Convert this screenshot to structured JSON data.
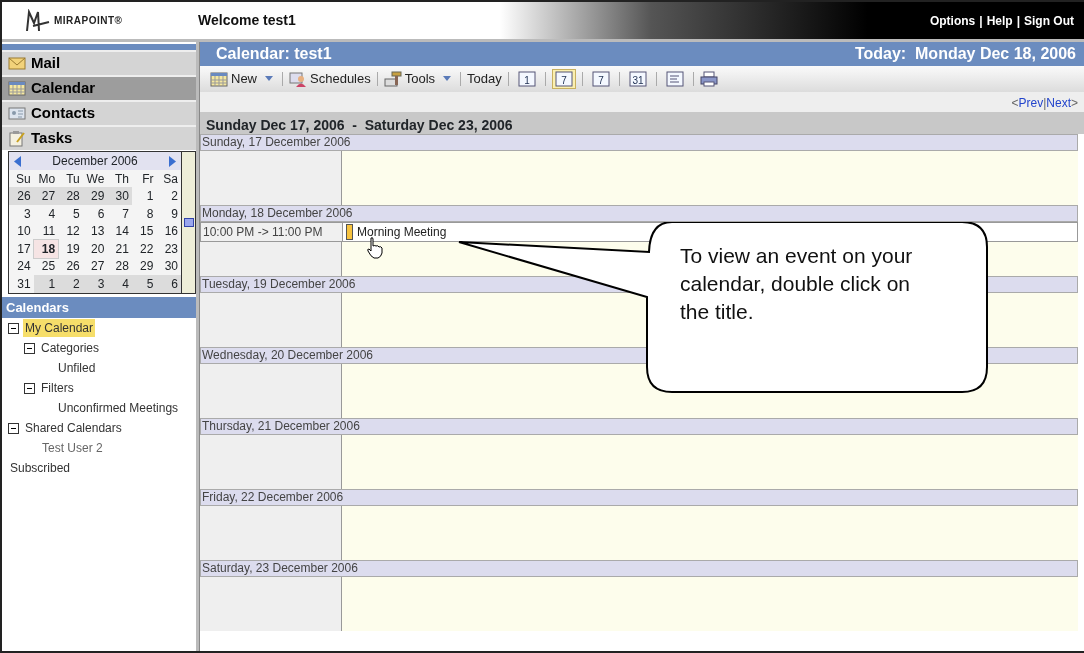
{
  "header": {
    "logo": "MIRAPOINT",
    "logo_mark": "®",
    "welcome": "Welcome test1",
    "links": [
      "Options",
      "Help",
      "Sign Out"
    ],
    "separator": "|"
  },
  "nav": [
    {
      "label": "Mail",
      "selected": false
    },
    {
      "label": "Calendar",
      "selected": true
    },
    {
      "label": "Contacts",
      "selected": false
    },
    {
      "label": "Tasks",
      "selected": false
    }
  ],
  "mini_calendar": {
    "month": "December 2006",
    "weekdays": [
      "Su",
      "Mo",
      "Tu",
      "We",
      "Th",
      "Fr",
      "Sa"
    ],
    "weeks": [
      [
        {
          "d": "26",
          "other_month": true,
          "today": false
        },
        {
          "d": "27",
          "other_month": true,
          "today": false
        },
        {
          "d": "28",
          "other_month": true,
          "today": false
        },
        {
          "d": "29",
          "other_month": true,
          "today": false
        },
        {
          "d": "30",
          "other_month": true,
          "today": false
        },
        {
          "d": "1",
          "other_month": false,
          "today": false
        },
        {
          "d": "2",
          "other_month": false,
          "today": false
        }
      ],
      [
        {
          "d": "3",
          "other_month": false,
          "today": false
        },
        {
          "d": "4",
          "other_month": false,
          "today": false
        },
        {
          "d": "5",
          "other_month": false,
          "today": false
        },
        {
          "d": "6",
          "other_month": false,
          "today": false
        },
        {
          "d": "7",
          "other_month": false,
          "today": false
        },
        {
          "d": "8",
          "other_month": false,
          "today": false
        },
        {
          "d": "9",
          "other_month": false,
          "today": false
        }
      ],
      [
        {
          "d": "10",
          "other_month": false,
          "today": false
        },
        {
          "d": "11",
          "other_month": false,
          "today": false
        },
        {
          "d": "12",
          "other_month": false,
          "today": false
        },
        {
          "d": "13",
          "other_month": false,
          "today": false
        },
        {
          "d": "14",
          "other_month": false,
          "today": false
        },
        {
          "d": "15",
          "other_month": false,
          "today": false
        },
        {
          "d": "16",
          "other_month": false,
          "today": false
        }
      ],
      [
        {
          "d": "17",
          "other_month": false,
          "today": false
        },
        {
          "d": "18",
          "other_month": false,
          "today": true
        },
        {
          "d": "19",
          "other_month": false,
          "today": false
        },
        {
          "d": "20",
          "other_month": false,
          "today": false
        },
        {
          "d": "21",
          "other_month": false,
          "today": false
        },
        {
          "d": "22",
          "other_month": false,
          "today": false
        },
        {
          "d": "23",
          "other_month": false,
          "today": false
        }
      ],
      [
        {
          "d": "24",
          "other_month": false,
          "today": false
        },
        {
          "d": "25",
          "other_month": false,
          "today": false
        },
        {
          "d": "26",
          "other_month": false,
          "today": false
        },
        {
          "d": "27",
          "other_month": false,
          "today": false
        },
        {
          "d": "28",
          "other_month": false,
          "today": false
        },
        {
          "d": "29",
          "other_month": false,
          "today": false
        },
        {
          "d": "30",
          "other_month": false,
          "today": false
        }
      ],
      [
        {
          "d": "31",
          "other_month": false,
          "today": false
        },
        {
          "d": "1",
          "other_month": true,
          "today": false
        },
        {
          "d": "2",
          "other_month": true,
          "today": false
        },
        {
          "d": "3",
          "other_month": true,
          "today": false
        },
        {
          "d": "4",
          "other_month": true,
          "today": false
        },
        {
          "d": "5",
          "other_month": true,
          "today": false
        },
        {
          "d": "6",
          "other_month": true,
          "today": false
        }
      ]
    ]
  },
  "calendars": {
    "title": "Calendars",
    "tree": [
      {
        "label": "My Calendar",
        "selected": true,
        "expanded": true,
        "children": [
          {
            "label": "Categories",
            "selected": false,
            "expanded": true,
            "children": [
              {
                "label": "Unfiled",
                "selected": false
              }
            ]
          },
          {
            "label": "Filters",
            "selected": false,
            "expanded": true,
            "children": [
              {
                "label": "Unconfirmed Meetings",
                "selected": false
              }
            ]
          }
        ]
      },
      {
        "label": "Shared Calendars",
        "selected": false,
        "expanded": true,
        "children": [
          {
            "label": "Test User 2",
            "selected": false
          }
        ]
      },
      {
        "label": "Subscribed",
        "selected": false
      }
    ]
  },
  "main": {
    "title": "Calendar: test1",
    "today": "Today:  Monday Dec 18, 2006",
    "toolbar": [
      {
        "kind": "menu",
        "label": "New"
      },
      {
        "kind": "sep"
      },
      {
        "kind": "text",
        "label": "Schedules"
      },
      {
        "kind": "sep"
      },
      {
        "kind": "menu",
        "label": "Tools"
      },
      {
        "kind": "sep"
      },
      {
        "kind": "text",
        "label": "Today"
      },
      {
        "kind": "sep"
      },
      {
        "kind": "view",
        "glyph": "1",
        "selected": false
      },
      {
        "kind": "sep"
      },
      {
        "kind": "view",
        "glyph": "7",
        "selected": true
      },
      {
        "kind": "sep"
      },
      {
        "kind": "view",
        "glyph": "7",
        "selected": false
      },
      {
        "kind": "sep"
      },
      {
        "kind": "view",
        "glyph": "31",
        "selected": false
      },
      {
        "kind": "sep"
      },
      {
        "kind": "list",
        "selected": false
      },
      {
        "kind": "sep"
      },
      {
        "kind": "print"
      }
    ],
    "pager": {
      "open": "<",
      "prev": "Prev",
      "separator": "|",
      "next": "Next",
      "close": ">"
    },
    "range": "Sunday Dec 17, 2006  -  Saturday Dec 23, 2006",
    "days": [
      {
        "label": "Sunday, 17 December 2006"
      },
      {
        "label": "Monday, 18 December 2006",
        "events": [
          {
            "time": "10:00 PM  -> 11:00 PM",
            "title": "Morning Meeting"
          }
        ]
      },
      {
        "label": "Tuesday, 19 December 2006"
      },
      {
        "label": "Wednesday, 20 December 2006"
      },
      {
        "label": "Thursday, 21 December 2006"
      },
      {
        "label": "Friday, 22 December 2006"
      },
      {
        "label": "Saturday, 23 December 2006"
      }
    ]
  },
  "callout": "To view an event on your calendar, double click on the title."
}
